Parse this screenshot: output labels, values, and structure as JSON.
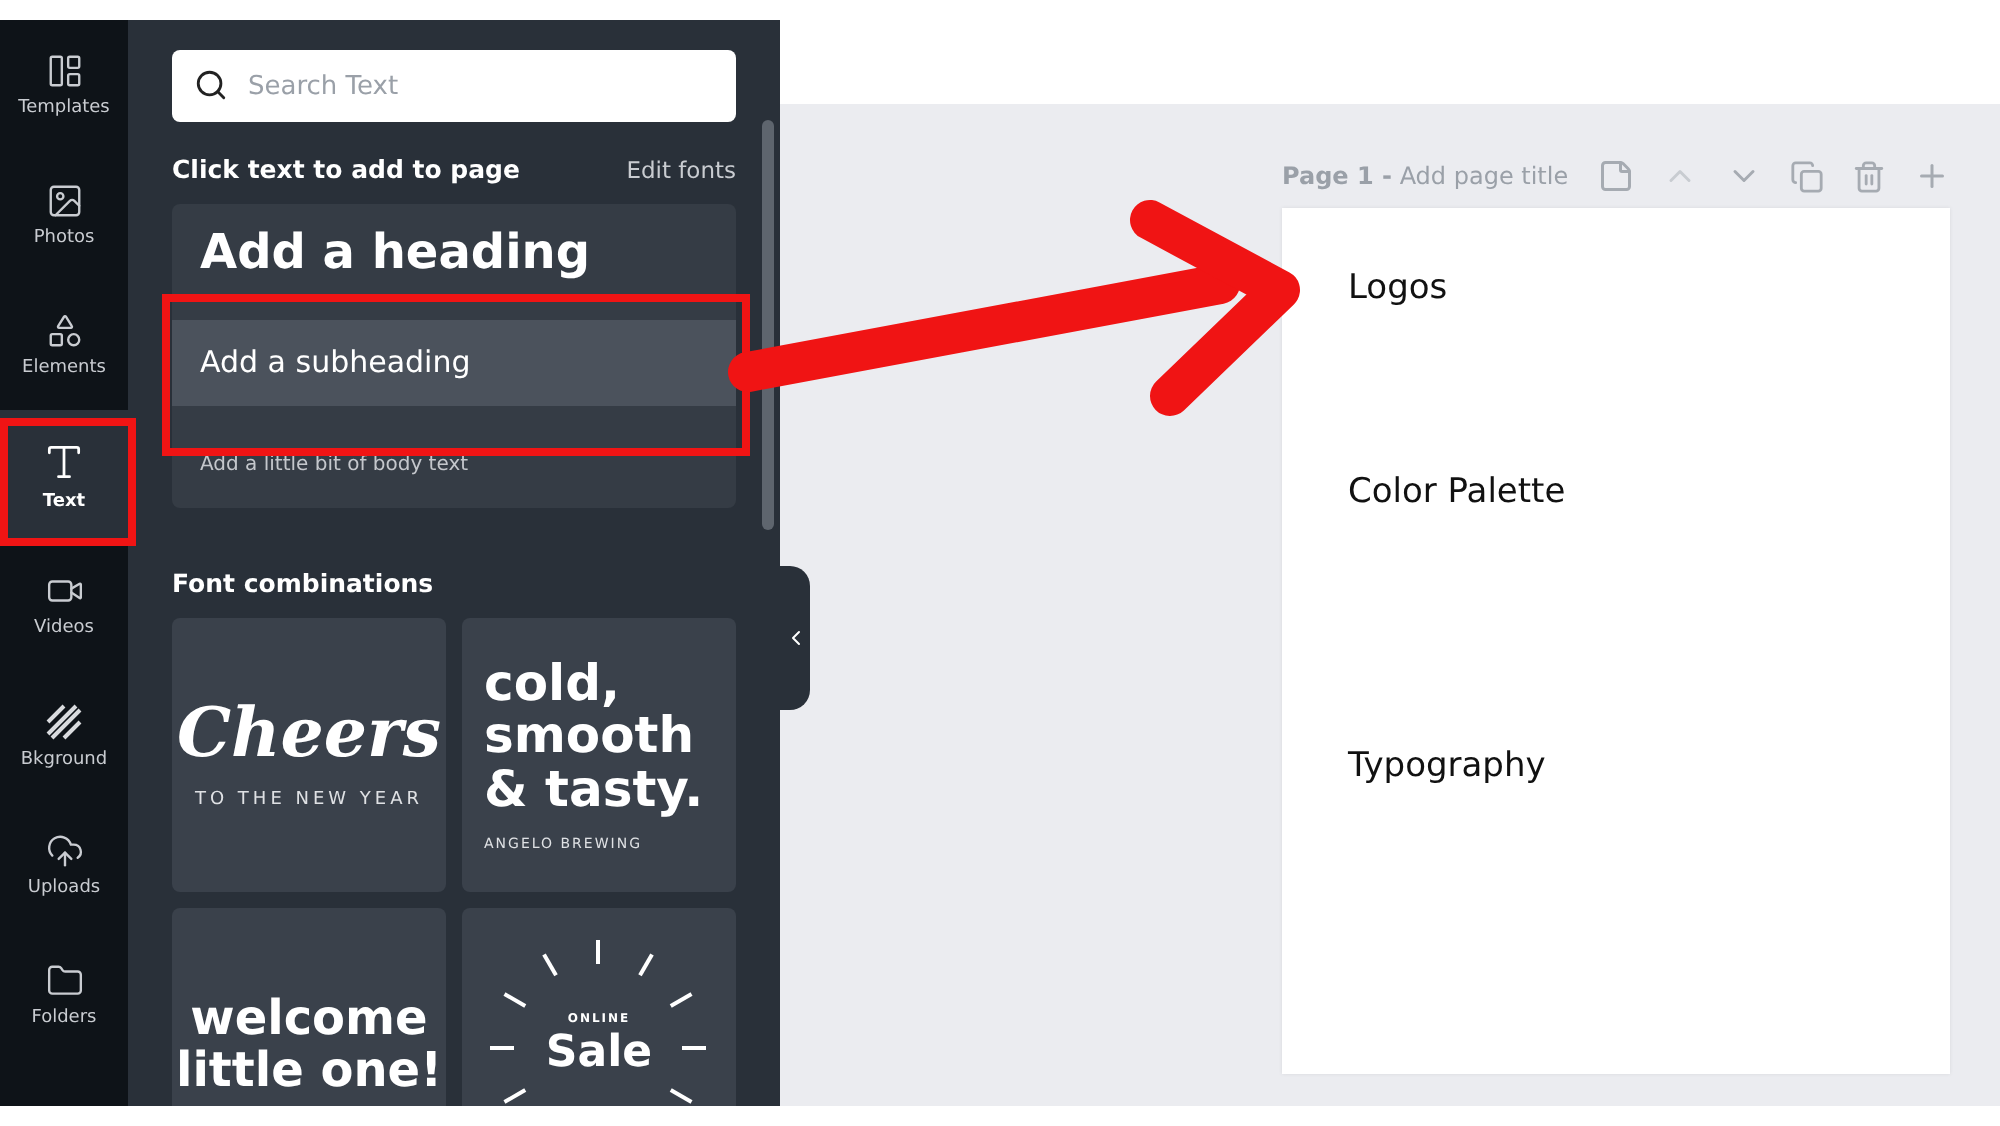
{
  "sidebar": {
    "items": [
      {
        "label": "Templates",
        "selected": false
      },
      {
        "label": "Photos",
        "selected": false
      },
      {
        "label": "Elements",
        "selected": false
      },
      {
        "label": "Text",
        "selected": true
      },
      {
        "label": "Videos",
        "selected": false
      },
      {
        "label": "Bkground",
        "selected": false
      },
      {
        "label": "Uploads",
        "selected": false
      },
      {
        "label": "Folders",
        "selected": false
      }
    ]
  },
  "panel": {
    "search": {
      "placeholder": "Search Text"
    },
    "section_title": "Click text to add to page",
    "edit_link": "Edit fonts",
    "text_styles": [
      {
        "kind": "heading",
        "label": "Add a heading",
        "selected": false
      },
      {
        "kind": "subheading",
        "label": "Add a subheading",
        "selected": true
      },
      {
        "kind": "body",
        "label": "Add a little bit of body text",
        "selected": false
      }
    ],
    "combinations_title": "Font combinations",
    "combinations": [
      {
        "kind": "script",
        "title": "Cheers",
        "subtitle": "TO THE NEW YEAR"
      },
      {
        "kind": "bold",
        "title": "cold, smooth & tasty.",
        "subtitle": "ANGELO BREWING"
      },
      {
        "kind": "playful",
        "title": "welcome little one!"
      },
      {
        "kind": "burst",
        "kicker": "ONLINE",
        "title": "Sale"
      }
    ]
  },
  "page": {
    "label": "Page 1 -",
    "title_placeholder": "Add page title",
    "texts": [
      "Logos",
      "Color Palette",
      "Typography"
    ]
  },
  "annotations": {
    "highlight_sidebar": true,
    "highlight_style": true,
    "arrow": true
  }
}
